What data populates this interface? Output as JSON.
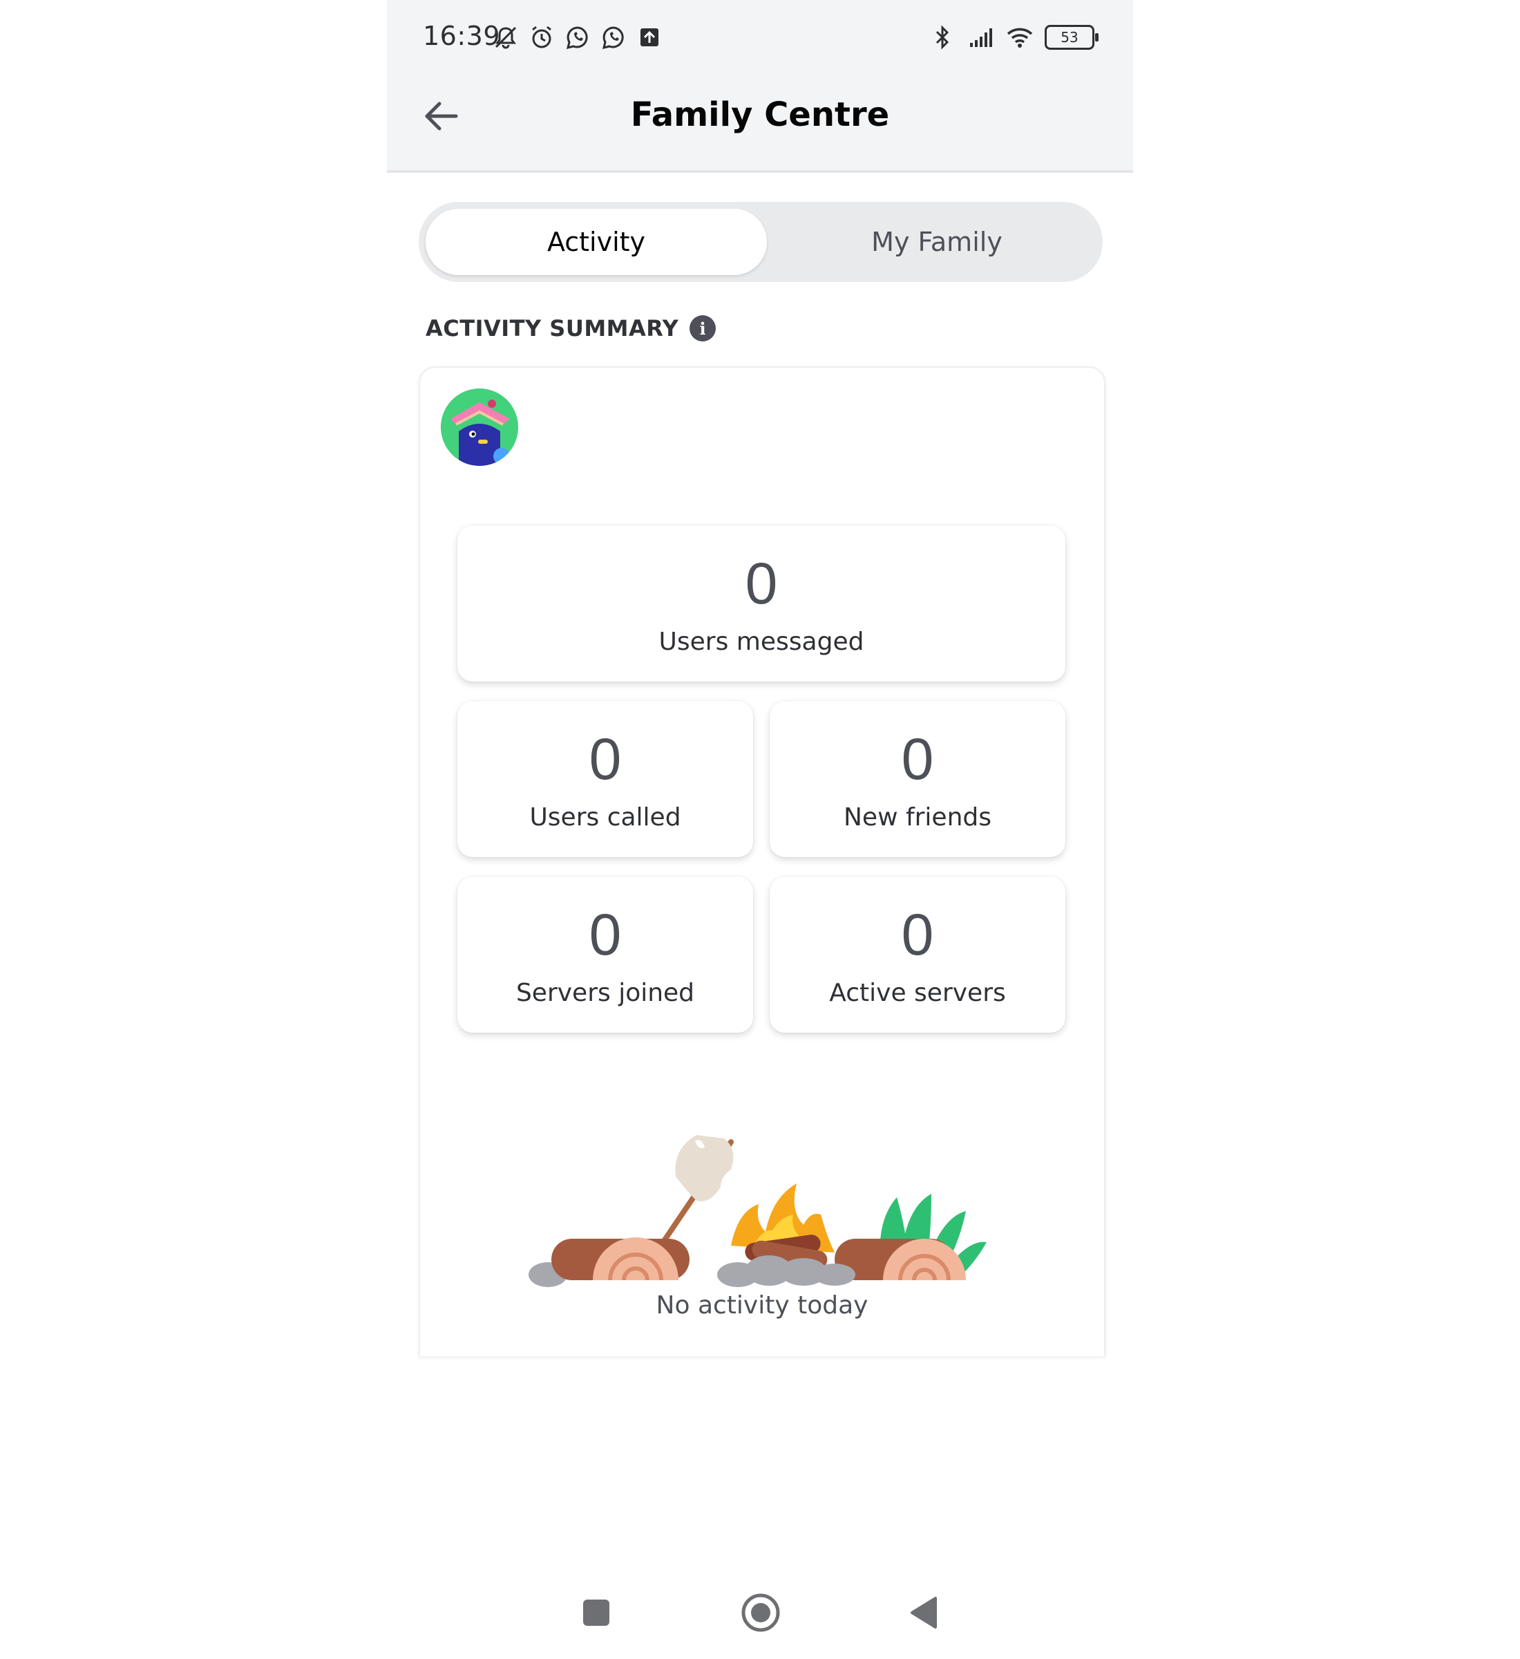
{
  "status_bar": {
    "time": "16:39",
    "battery": "53",
    "left_icons": [
      "mute-bell-icon",
      "alarm-icon",
      "whatsapp-icon",
      "whatsapp-icon",
      "upload-icon"
    ],
    "right_icons": [
      "bluetooth-icon",
      "signal-icon",
      "wifi-icon",
      "battery-icon"
    ]
  },
  "header": {
    "title": "Family Centre",
    "back_icon": "arrow-left-icon"
  },
  "tabs": [
    {
      "label": "Activity",
      "selected": true
    },
    {
      "label": "My Family",
      "selected": false
    }
  ],
  "section": {
    "title": "ACTIVITY SUMMARY",
    "info_icon": "info-icon"
  },
  "stats": [
    {
      "value": "0",
      "label": "Users messaged"
    },
    {
      "value": "0",
      "label": "Users called"
    },
    {
      "value": "0",
      "label": "New friends"
    },
    {
      "value": "0",
      "label": "Servers joined"
    },
    {
      "value": "0",
      "label": "Active servers"
    }
  ],
  "empty_state": {
    "text": "No activity today",
    "illustration": "campfire-illustration"
  },
  "colors": {
    "header_bg": "#f3f4f5",
    "text_primary": "#060607",
    "text_secondary": "#4e5058",
    "avatar_bg": "#43d17c"
  },
  "nav_bar": [
    "recent-apps-icon",
    "home-icon",
    "back-triangle-icon"
  ]
}
